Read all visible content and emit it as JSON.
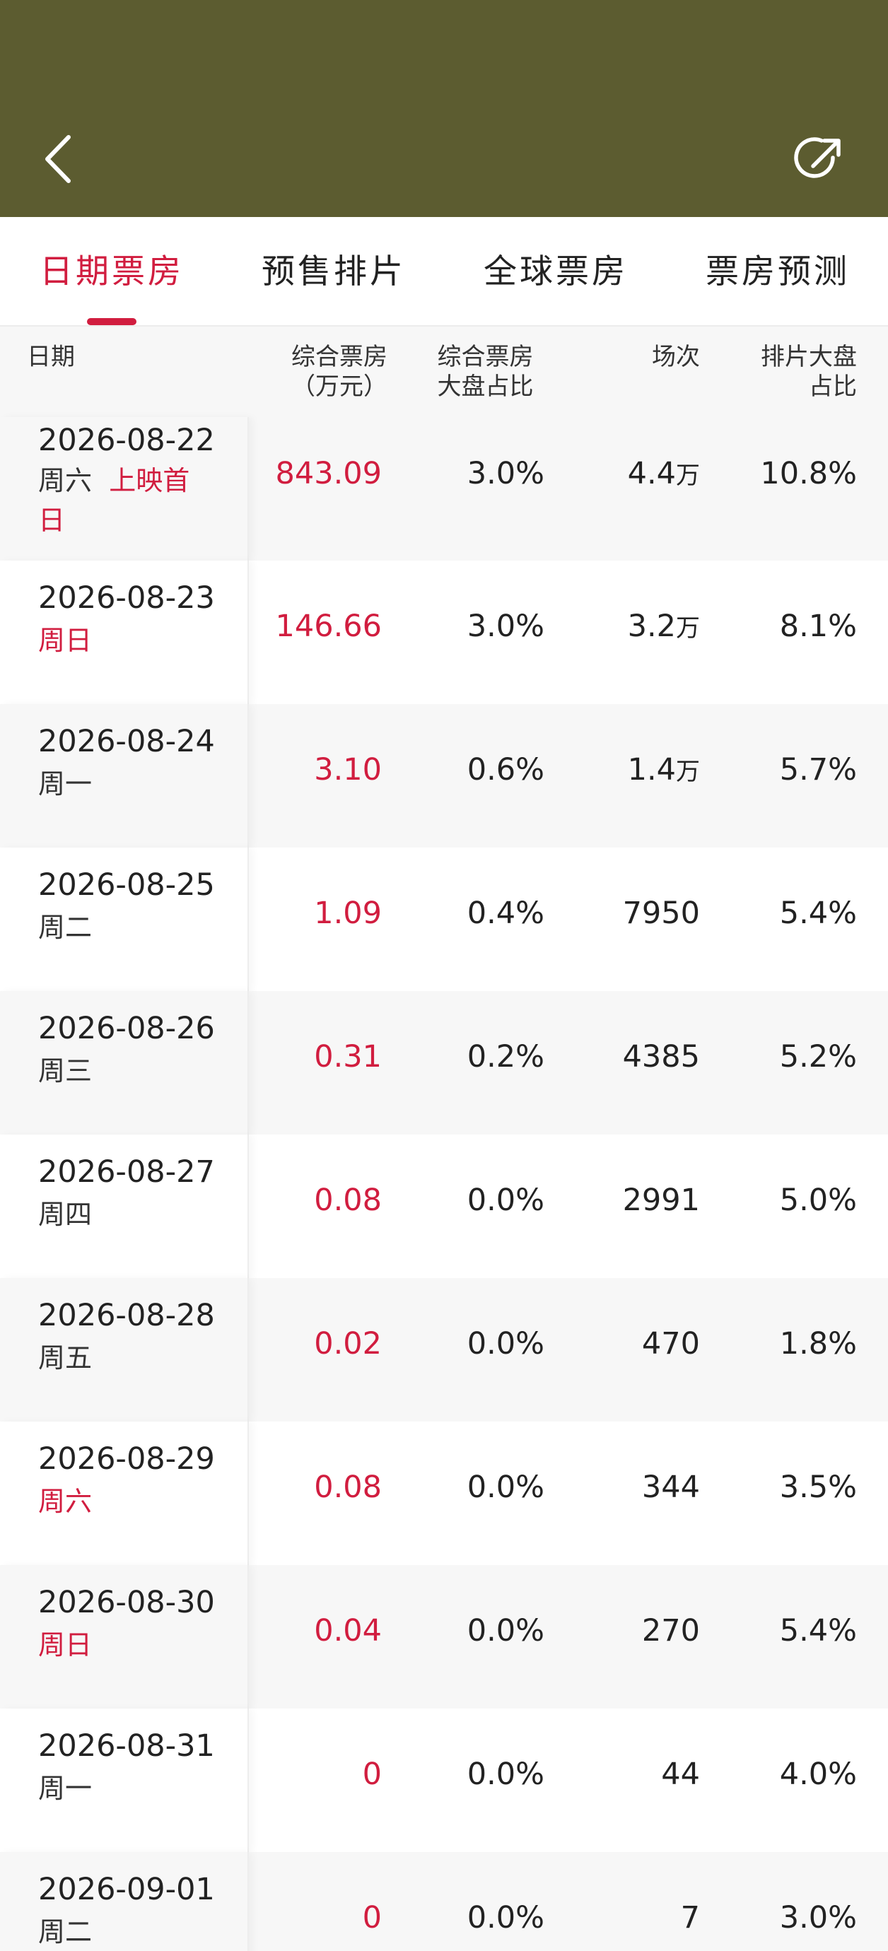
{
  "colors": {
    "header_bg": "#5c5c30",
    "accent": "#d11d3f"
  },
  "header": {
    "title": "",
    "back_icon": "chevron-left-icon",
    "share_icon": "share-icon"
  },
  "tabs": [
    {
      "label": "日期票房",
      "active": true
    },
    {
      "label": "预售排片",
      "active": false
    },
    {
      "label": "全球票房",
      "active": false
    },
    {
      "label": "票房预测",
      "active": false
    }
  ],
  "table": {
    "headers": {
      "date": "日期",
      "box_office": [
        "综合票房",
        "（万元）"
      ],
      "share": [
        "综合票房",
        "大盘占比"
      ],
      "shows": "场次",
      "schedule_share": [
        "排片大盘",
        "占比"
      ]
    },
    "rows": [
      {
        "date": "2026-08-22",
        "weekday": "周六",
        "note": "上映首日",
        "box": "843.09",
        "share": "3.0%",
        "shows": "4.4",
        "shows_unit": "万",
        "sched": "10.8%",
        "weekend": false
      },
      {
        "date": "2026-08-23",
        "weekday": "周日",
        "note": "",
        "box": "146.66",
        "share": "3.0%",
        "shows": "3.2",
        "shows_unit": "万",
        "sched": "8.1%",
        "weekend": true
      },
      {
        "date": "2026-08-24",
        "weekday": "周一",
        "note": "",
        "box": "3.10",
        "share": "0.6%",
        "shows": "1.4",
        "shows_unit": "万",
        "sched": "5.7%",
        "weekend": false
      },
      {
        "date": "2026-08-25",
        "weekday": "周二",
        "note": "",
        "box": "1.09",
        "share": "0.4%",
        "shows": "7950",
        "shows_unit": "",
        "sched": "5.4%",
        "weekend": false
      },
      {
        "date": "2026-08-26",
        "weekday": "周三",
        "note": "",
        "box": "0.31",
        "share": "0.2%",
        "shows": "4385",
        "shows_unit": "",
        "sched": "5.2%",
        "weekend": false
      },
      {
        "date": "2026-08-27",
        "weekday": "周四",
        "note": "",
        "box": "0.08",
        "share": "0.0%",
        "shows": "2991",
        "shows_unit": "",
        "sched": "5.0%",
        "weekend": false
      },
      {
        "date": "2026-08-28",
        "weekday": "周五",
        "note": "",
        "box": "0.02",
        "share": "0.0%",
        "shows": "470",
        "shows_unit": "",
        "sched": "1.8%",
        "weekend": false
      },
      {
        "date": "2026-08-29",
        "weekday": "周六",
        "note": "",
        "box": "0.08",
        "share": "0.0%",
        "shows": "344",
        "shows_unit": "",
        "sched": "3.5%",
        "weekend": true
      },
      {
        "date": "2026-08-30",
        "weekday": "周日",
        "note": "",
        "box": "0.04",
        "share": "0.0%",
        "shows": "270",
        "shows_unit": "",
        "sched": "5.4%",
        "weekend": true
      },
      {
        "date": "2026-08-31",
        "weekday": "周一",
        "note": "",
        "box": "0",
        "share": "0.0%",
        "shows": "44",
        "shows_unit": "",
        "sched": "4.0%",
        "weekend": false
      },
      {
        "date": "2026-09-01",
        "weekday": "周二",
        "note": "",
        "box": "0",
        "share": "0.0%",
        "shows": "7",
        "shows_unit": "",
        "sched": "3.0%",
        "weekend": false
      }
    ]
  }
}
